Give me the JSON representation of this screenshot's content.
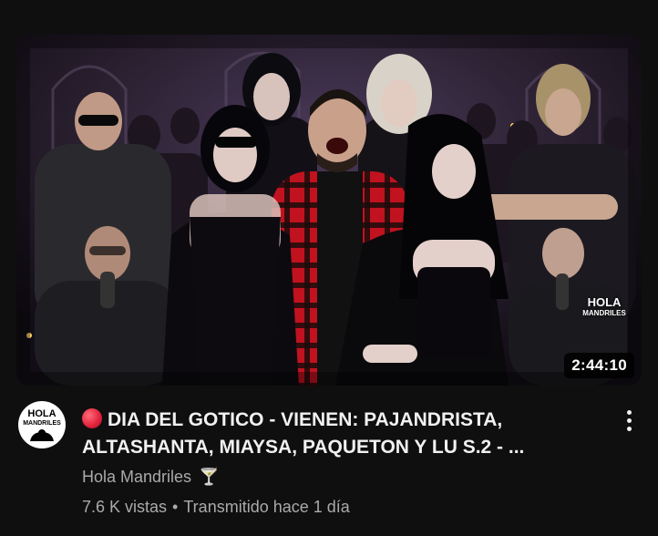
{
  "video": {
    "title": "DIA DEL GOTICO - VIENEN: PAJANDRISTA, ALTASHANTA, MIAYSA, PAQUETON Y LU  S.2 - ...",
    "duration": "2:44:10",
    "channel_name": "Hola Mandriles",
    "channel_emoji": "🍸",
    "views": "7.6 K vistas",
    "separator": "•",
    "streamed": "Transmitido hace 1 día",
    "live_indicator_icon": "red-circle-icon",
    "thumbnail_logo_line1": "HOLA",
    "thumbnail_logo_line2": "MANDRILES"
  },
  "avatar": {
    "line1": "HOLA",
    "line2": "MANDRILES"
  },
  "colors": {
    "background": "#0f0f0f",
    "title": "#f1f1f1",
    "meta": "#aaaaaa",
    "live_red": "#e0203a",
    "plaid_red": "#c1121f"
  },
  "menu_icon": "three-dots-vertical-icon"
}
